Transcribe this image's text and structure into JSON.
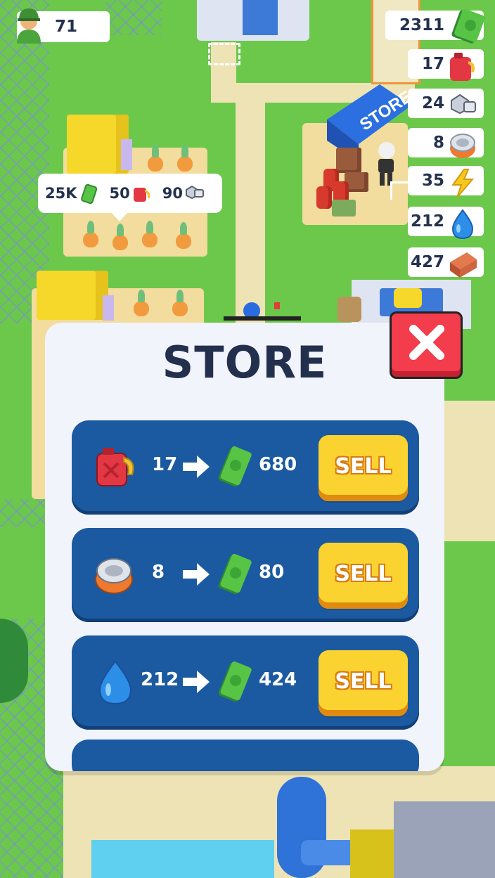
{
  "hud": {
    "player_count": "71",
    "resources": [
      {
        "name": "cash",
        "value": "2311",
        "icon": "cash-icon"
      },
      {
        "name": "fuel",
        "value": "17",
        "icon": "fuel-can-icon"
      },
      {
        "name": "bolts",
        "value": "24",
        "icon": "bolt-icon"
      },
      {
        "name": "cans",
        "value": "8",
        "icon": "tin-can-icon"
      },
      {
        "name": "energy",
        "value": "35",
        "icon": "lightning-icon"
      },
      {
        "name": "water",
        "value": "212",
        "icon": "water-drop-icon"
      },
      {
        "name": "bricks",
        "value": "427",
        "icon": "brick-icon"
      }
    ]
  },
  "field_bubble": {
    "cash_cost": "25K",
    "fuel_cost": "50",
    "bolt_cost": "90"
  },
  "world": {
    "store_sign": "STORE"
  },
  "store": {
    "title": "STORE",
    "offers": [
      {
        "item": "fuel",
        "icon": "fuel-can-icon",
        "quantity": "17",
        "price": "680",
        "button": "SELL"
      },
      {
        "item": "cans",
        "icon": "tin-can-icon",
        "quantity": "8",
        "price": "80",
        "button": "SELL"
      },
      {
        "item": "water",
        "icon": "water-drop-icon",
        "quantity": "212",
        "price": "424",
        "button": "SELL"
      }
    ]
  },
  "colors": {
    "panel_bg": "#f2f4fb",
    "offer_bg": "#1b5aa0",
    "sell_button": "#fbd330",
    "close_button": "#f43d4c",
    "grass": "#6cc84a"
  }
}
